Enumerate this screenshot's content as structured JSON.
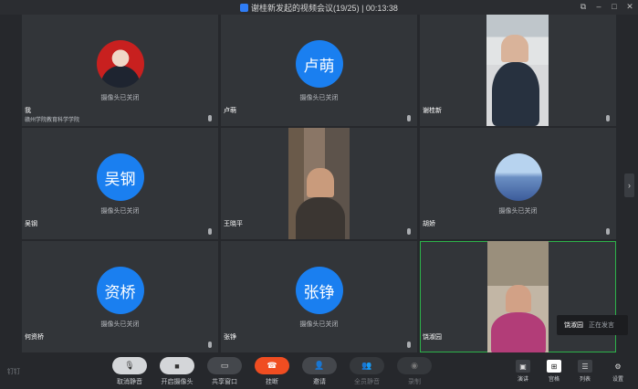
{
  "window": {
    "title": "谢桂新发起的视频会议(19/25) | 00:13:38"
  },
  "tiles": [
    {
      "name": "我",
      "subtitle": "赣州学院教育科学学院",
      "avatar_text": "",
      "status": "摄像头已关闭"
    },
    {
      "name": "卢萌",
      "avatar_text": "卢萌",
      "status": "摄像头已关闭"
    },
    {
      "name": "谢桂新"
    },
    {
      "name": "吴钢",
      "avatar_text": "吴钢",
      "status": "摄像头已关闭"
    },
    {
      "name": "王晓平"
    },
    {
      "name": "胡娇",
      "avatar_text": "",
      "status": "摄像头已关闭"
    },
    {
      "name": "何资桥",
      "avatar_text": "资桥",
      "status": "摄像头已关闭"
    },
    {
      "name": "张铮",
      "avatar_text": "张铮",
      "status": "摄像头已关闭"
    },
    {
      "name": "饶淑园"
    }
  ],
  "speaking": {
    "name": "饶淑园",
    "status": "正在发言"
  },
  "toolbar": {
    "unmute": "取消静音",
    "camera": "开启摄像头",
    "share": "共享窗口",
    "hangup": "挂断",
    "invite": "邀请",
    "mute_all": "全员静音",
    "record": "录制"
  },
  "views": {
    "speaker": "演讲",
    "gallery": "宫格",
    "list": "列表",
    "settings": "设置"
  },
  "brand": "钉钉",
  "colors": {
    "accent": "#1a7ff0",
    "hangup": "#f04d21",
    "active_border": "#2db34a"
  }
}
